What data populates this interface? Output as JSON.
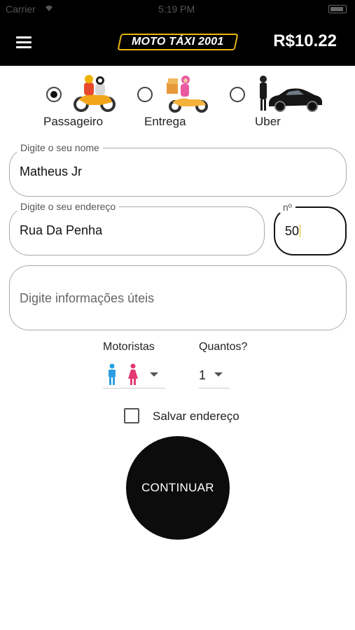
{
  "status_bar": {
    "carrier": "Carrier",
    "time": "5:19 PM"
  },
  "app_bar": {
    "logo_text": "MOTO TÁXI 2001",
    "balance": "R$10.22"
  },
  "service_types": [
    {
      "label": "Passageiro",
      "selected": true
    },
    {
      "label": "Entrega",
      "selected": false
    },
    {
      "label": "Uber",
      "selected": false
    }
  ],
  "form": {
    "name": {
      "label": "Digite o seu nome",
      "value": "Matheus Jr"
    },
    "address": {
      "label": "Digite o seu endereço",
      "value": "Rua Da Penha"
    },
    "number": {
      "label": "nº",
      "value": "50"
    },
    "info": {
      "placeholder": "Digite informações úteis"
    }
  },
  "drivers": {
    "label": "Motoristas"
  },
  "quantity": {
    "label": "Quantos?",
    "value": "1"
  },
  "save_address": {
    "label": "Salvar endereço",
    "checked": false
  },
  "continue_label": "CONTINUAR",
  "colors": {
    "accent": "#e8b712",
    "male": "#2a9fe0",
    "female": "#e33a73",
    "app_bar": "#000000"
  }
}
